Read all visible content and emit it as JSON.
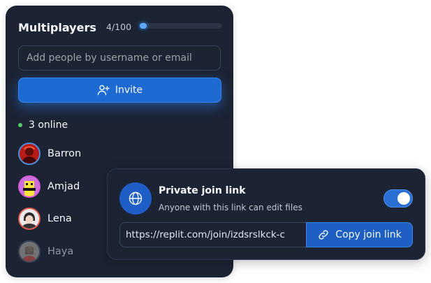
{
  "panel": {
    "title": "Multiplayers",
    "count": "4/100",
    "progress_fraction": 0.04,
    "search_placeholder": "Add people by username or email",
    "invite_label": "Invite",
    "online_label": "3 online",
    "users": [
      {
        "name": "Barron",
        "ring": "#4a8fe0",
        "status": "online"
      },
      {
        "name": "Amjad",
        "ring": "#d45bd9",
        "status": "online"
      },
      {
        "name": "Lena",
        "ring": "#e0564a",
        "status": "online"
      },
      {
        "name": "Haya",
        "ring": "#3c445c",
        "status": "offline"
      }
    ]
  },
  "join_card": {
    "title": "Private join link",
    "subtitle": "Anyone with this link can edit files",
    "toggle_on": true,
    "link": "https://replit.com/join/izdsrslkck-c",
    "copy_label": "Copy join link"
  },
  "colors": {
    "panel_bg": "#1c2333",
    "accent_blue": "#1e6ad3",
    "online_green": "#58c96b"
  }
}
